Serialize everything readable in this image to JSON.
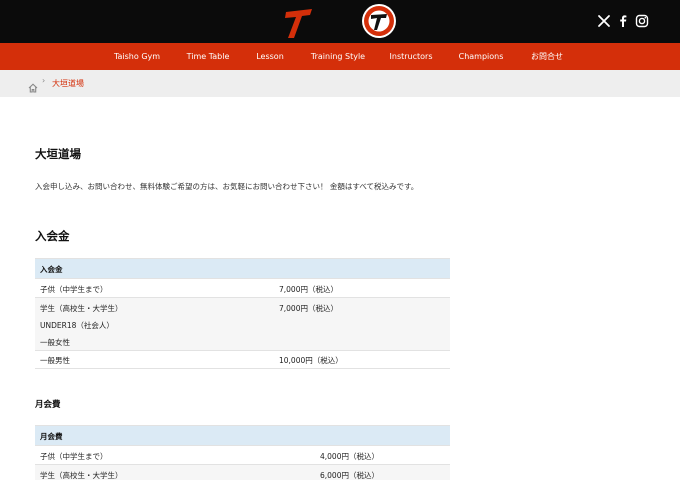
{
  "header": {
    "logo_text": "TAISHO GYM",
    "social": [
      "x-icon",
      "facebook-icon",
      "instagram-icon"
    ]
  },
  "nav": {
    "items": [
      {
        "label": "Taisho Gym"
      },
      {
        "label": "Time Table"
      },
      {
        "label": "Lesson"
      },
      {
        "label": "Training Style"
      },
      {
        "label": "Instructors"
      },
      {
        "label": "Champions"
      },
      {
        "label": "お問合せ"
      }
    ]
  },
  "breadcrumb": {
    "current": "大垣道場"
  },
  "page": {
    "title": "大垣道場",
    "intro": "入会申し込み、お問い合わせ、無料体験ご希望の方は、お気軽にお問い合わせ下さい！ 金額はすべて税込みです。"
  },
  "joining": {
    "heading": "入会金",
    "table_header": "入会金",
    "rows": [
      {
        "label": "子供（中学生まで）",
        "price": "7,000円（税込）"
      },
      {
        "label_lines": [
          "学生（高校生・大学生）",
          "UNDER18（社会人）",
          "一般女性"
        ],
        "price": "7,000円（税込）"
      },
      {
        "label": "一般男性",
        "price": "10,000円（税込）"
      }
    ]
  },
  "monthly": {
    "heading": "月会費",
    "table_header": "月会費",
    "rows": [
      {
        "label": "子供（中学生まで）",
        "price": "4,000円（税込）"
      },
      {
        "label": "学生（高校生・大学生）",
        "price": "6,000円（税込）"
      }
    ]
  },
  "colors": {
    "header_bg": "#0b0b0b",
    "nav_bg": "#d42f0a",
    "breadcrumb_bg": "#eeeeee",
    "accent": "#d42f0a",
    "table_header_bg": "#dbeaf5"
  }
}
